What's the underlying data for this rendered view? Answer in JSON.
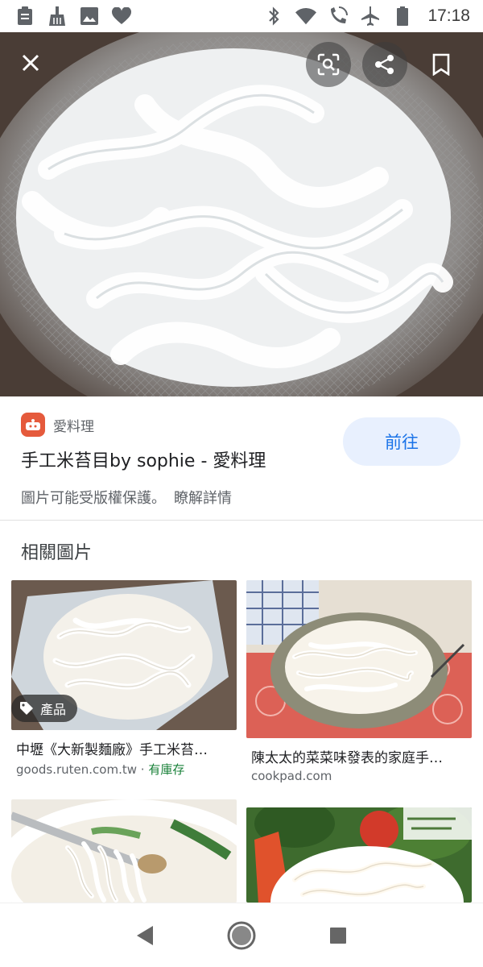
{
  "status_bar": {
    "time": "17:18",
    "left_icons": [
      "clipboard-icon",
      "broom-icon",
      "image-icon",
      "heart-icon"
    ],
    "right_icons": [
      "bluetooth-icon",
      "wifi-icon",
      "wifi-call-icon",
      "airplane-icon",
      "battery-icon"
    ]
  },
  "hero": {
    "buttons": [
      "close-icon",
      "lens-icon",
      "share-icon",
      "bookmark-icon"
    ]
  },
  "source": {
    "site_name": "愛料理",
    "title": "手工米苔目by sophie - 愛料理",
    "visit_label": "前往",
    "copyright_text": "圖片可能受版權保護。",
    "learn_more_label": "瞭解詳情"
  },
  "related": {
    "heading": "相關圖片",
    "items": [
      {
        "caption": "中壢《大新製麵廠》手工米苔…",
        "source": "goods.ruten.com.tw",
        "separator": " · ",
        "stock": "有庫存",
        "badge": "產品"
      },
      {
        "caption": "陳太太的菜菜味發表的家庭手…",
        "source": "cookpad.com"
      },
      {
        "caption": "",
        "source": ""
      },
      {
        "caption": "",
        "source": ""
      }
    ]
  },
  "colors": {
    "accent": "#1a73e8",
    "visit_bg": "#e8f0fe",
    "site_logo": "#e55a3c",
    "stock_green": "#188038"
  },
  "nav_bar": {
    "buttons": [
      "back-icon",
      "home-icon",
      "recents-icon"
    ]
  }
}
